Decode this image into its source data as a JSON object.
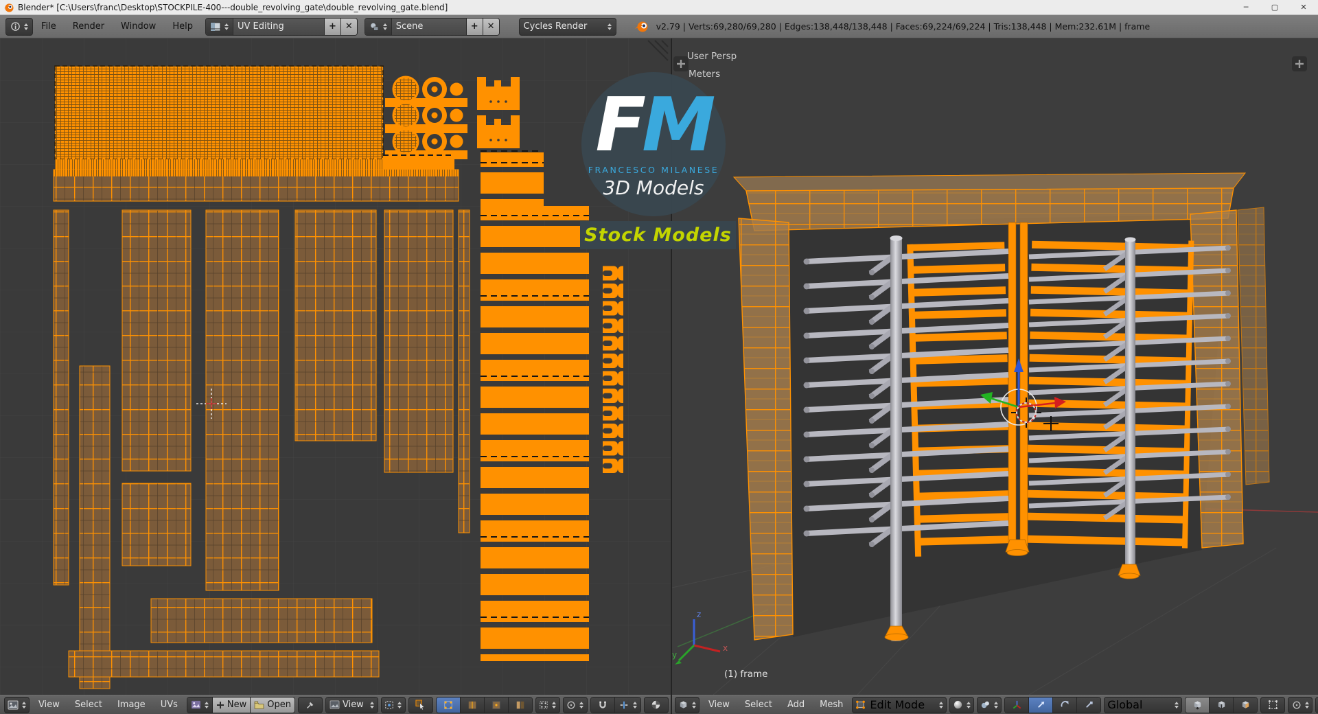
{
  "window": {
    "title": "Blender* [C:\\Users\\franc\\Desktop\\STOCKPILE-400---double_revolving_gate\\double_revolving_gate.blend]",
    "min_icon": "─",
    "max_icon": "▢",
    "close_icon": "✕"
  },
  "menubar": {
    "menus": [
      "File",
      "Render",
      "Window",
      "Help"
    ],
    "layout_value": "UV Editing",
    "layout_add": "+",
    "layout_close": "✕",
    "scene_value": "Scene",
    "scene_add": "+",
    "scene_close": "✕",
    "engine_value": "Cycles Render",
    "stats": "v2.79 | Verts:69,280/69,280 | Edges:138,448/138,448 | Faces:69,224/69,224 | Tris:138,448 | Mem:232.61M | frame"
  },
  "uv_editor": {
    "menus": [
      "View",
      "Select",
      "Image",
      "UVs"
    ],
    "new_label": "New",
    "open_label": "Open",
    "view_label": "View"
  },
  "viewport": {
    "menus": [
      "View",
      "Select",
      "Add",
      "Mesh"
    ],
    "mode_value": "Edit Mode",
    "orientation_value": "Global",
    "overlay_persp": "User Persp",
    "overlay_unit": "Meters",
    "overlay_object": "(1) frame",
    "axis_x": "x",
    "axis_y": "y",
    "axis_z": "z"
  },
  "watermark": {
    "f": "F",
    "m": "M",
    "name": "FRANCESCO MILANESE",
    "models": "3D Models",
    "banner": "Stock Models"
  },
  "colors": {
    "selection_orange": "#ff9100",
    "brand_blue": "#3aa9dd",
    "banner_yellow": "#c3d500",
    "active_blue": "#4f74ad",
    "face_brown": "#7b5b3a"
  }
}
